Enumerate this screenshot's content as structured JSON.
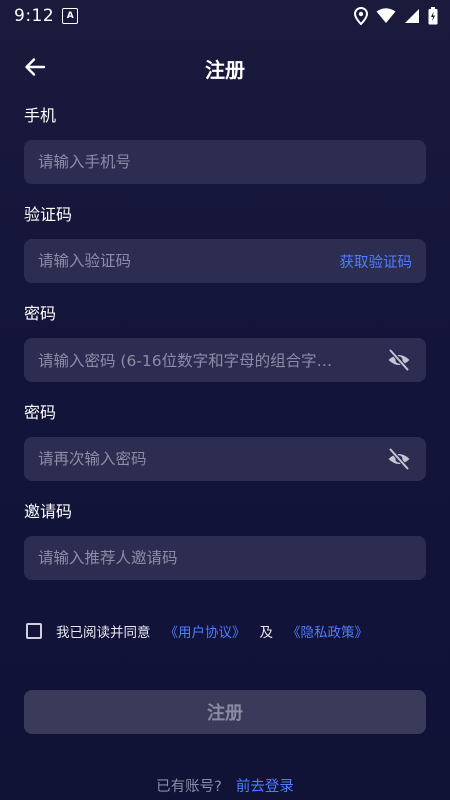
{
  "status_bar": {
    "time": "9:12",
    "app_badge": "A"
  },
  "header": {
    "title": "注册"
  },
  "fields": {
    "phone": {
      "label": "手机",
      "placeholder": "请输入手机号"
    },
    "code": {
      "label": "验证码",
      "placeholder": "请输入验证码",
      "action": "获取验证码"
    },
    "password": {
      "label": "密码",
      "placeholder": "请输入密码 (6-16位数字和字母的组合字…"
    },
    "password_confirm": {
      "label": "密码",
      "placeholder": "请再次输入密码"
    },
    "invite": {
      "label": "邀请码",
      "placeholder": "请输入推荐人邀请码"
    }
  },
  "agreement": {
    "text": "我已阅读并同意",
    "user_agreement": "《用户协议》",
    "and": "及",
    "privacy_policy": "《隐私政策》",
    "checked": false
  },
  "submit": {
    "label": "注册"
  },
  "login": {
    "prompt": "已有账号?",
    "link": "前去登录"
  },
  "colors": {
    "background": "#13143a",
    "input_bg": "#2d2d52",
    "accent": "#4f7dff",
    "placeholder": "#8c8ca6",
    "button_disabled": "#3a3a5a"
  },
  "icons": {
    "back": "arrow-left-icon",
    "eye_hidden": "eye-off-icon",
    "location": "location-icon",
    "wifi": "wifi-icon",
    "signal": "signal-icon",
    "battery": "battery-icon"
  }
}
